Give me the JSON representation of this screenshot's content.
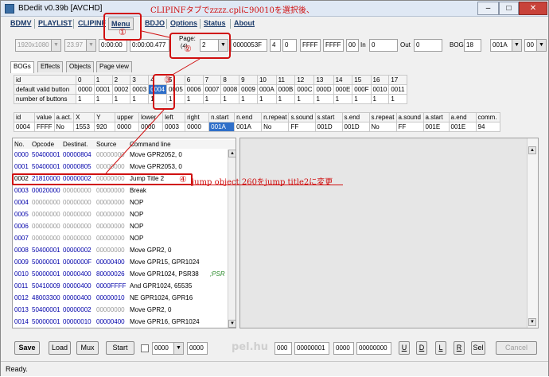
{
  "window": {
    "title": "BDedit v0.39b [AVCHD]",
    "close": "✕",
    "minimize": "–",
    "maximize": "□"
  },
  "annotations": {
    "top": "CLIPINFタブでzzzz.cplに90010を選択後、",
    "n1": "①",
    "n2": "②",
    "n3": "③",
    "n4": "④",
    "n4_text": "jump object 260をjump title2に変更"
  },
  "menu": {
    "items": [
      "BDMV",
      "PLAYLIST",
      "CLIPINF",
      "Menu",
      "BDJO",
      "Options",
      "Status",
      "About"
    ],
    "active": "Menu"
  },
  "toolbar": {
    "resolution": "1920x1080",
    "fps": "23.97",
    "time_in": "0:00:00",
    "time_out": "0:00:00.477",
    "page_label": "Page:",
    "page_count": "(4)",
    "page_value": "2",
    "hex1": "0000053F",
    "field_4": "4",
    "field_0": "0",
    "ffff1": "FFFF",
    "ffff2": "FFFF",
    "f00": "00",
    "in_label": "In",
    "in_value": "0",
    "out_label": "Out",
    "out_value": "0",
    "bog_label": "BOG",
    "bog_value": "18",
    "right_combo": "001A",
    "right_combo2": "00"
  },
  "tabs": [
    "BOGs",
    "Effects",
    "Objects",
    "Page view"
  ],
  "bog_table": {
    "row_id_label": "id",
    "columns": [
      "0",
      "1",
      "2",
      "3",
      "4",
      "5",
      "6",
      "7",
      "8",
      "9",
      "10",
      "11",
      "12",
      "13",
      "14",
      "15",
      "16",
      "17"
    ],
    "default_label": "default valid button",
    "default_values": [
      "0000",
      "0001",
      "0002",
      "0003",
      "0004",
      "0005",
      "0006",
      "0007",
      "0008",
      "0009",
      "000A",
      "000B",
      "000C",
      "000D",
      "000E",
      "000F",
      "0010",
      "0011"
    ],
    "count_label": "number of buttons",
    "count_values": [
      "1",
      "1",
      "1",
      "1",
      "1",
      "1",
      "1",
      "1",
      "1",
      "1",
      "1",
      "1",
      "1",
      "1",
      "1",
      "1",
      "1",
      "1"
    ]
  },
  "button_table": {
    "headers": [
      "id",
      "value",
      "a.act.",
      "X",
      "Y",
      "upper",
      "lower",
      "left",
      "right",
      "n.start",
      "n.end",
      "n.repeat",
      "s.sound",
      "s.start",
      "s.end",
      "s.repeat",
      "a.sound",
      "a.start",
      "a.end",
      "comm."
    ],
    "row": [
      "0004",
      "FFFF",
      "No",
      "1553",
      "920",
      "0000",
      "0000",
      "0003",
      "0000",
      "001A",
      "001A",
      "No",
      "FF",
      "001D",
      "001D",
      "No",
      "FF",
      "001E",
      "001E",
      "94"
    ]
  },
  "commands": {
    "headers": [
      "No.",
      "Opcode",
      "Destinat.",
      "Source",
      "Command line"
    ],
    "rows": [
      {
        "no": "0000",
        "op": "50400001",
        "dst": "00000804",
        "src": "00000000",
        "cmd": "Move GPR2052, 0",
        "note": ""
      },
      {
        "no": "0001",
        "op": "50400001",
        "dst": "00000805",
        "src": "00000000",
        "cmd": "Move GPR2053, 0",
        "note": ""
      },
      {
        "no": "0002",
        "op": "21810000",
        "dst": "00000002",
        "src": "00000000",
        "cmd": "Jump Title 2",
        "note": ""
      },
      {
        "no": "0003",
        "op": "00020000",
        "dst": "00000000",
        "src": "00000000",
        "cmd": "Break",
        "note": ""
      },
      {
        "no": "0004",
        "op": "00000000",
        "dst": "00000000",
        "src": "00000000",
        "cmd": "NOP",
        "note": ""
      },
      {
        "no": "0005",
        "op": "00000000",
        "dst": "00000000",
        "src": "00000000",
        "cmd": "NOP",
        "note": ""
      },
      {
        "no": "0006",
        "op": "00000000",
        "dst": "00000000",
        "src": "00000000",
        "cmd": "NOP",
        "note": ""
      },
      {
        "no": "0007",
        "op": "00000000",
        "dst": "00000000",
        "src": "00000000",
        "cmd": "NOP",
        "note": ""
      },
      {
        "no": "0008",
        "op": "50400001",
        "dst": "00000002",
        "src": "00000000",
        "cmd": "Move GPR2, 0",
        "note": ""
      },
      {
        "no": "0009",
        "op": "50000001",
        "dst": "0000000F",
        "src": "00000400",
        "cmd": "Move GPR15, GPR1024",
        "note": ""
      },
      {
        "no": "0010",
        "op": "50000001",
        "dst": "00000400",
        "src": "80000026",
        "cmd": "Move GPR1024, PSR38",
        "note": ";PSR"
      },
      {
        "no": "0011",
        "op": "50410009",
        "dst": "00000400",
        "src": "0000FFFF",
        "cmd": "And GPR1024, 65535",
        "note": ""
      },
      {
        "no": "0012",
        "op": "48003300",
        "dst": "00000400",
        "src": "00000010",
        "cmd": "NE GPR1024, GPR16",
        "note": ""
      },
      {
        "no": "0013",
        "op": "50400001",
        "dst": "00000002",
        "src": "00000000",
        "cmd": "Move GPR2, 0",
        "note": ""
      },
      {
        "no": "0014",
        "op": "50000001",
        "dst": "00000010",
        "src": "00000400",
        "cmd": "Move GPR16, GPR1024",
        "note": ""
      }
    ]
  },
  "bottom": {
    "save": "Save",
    "load": "Load",
    "mux": "Mux",
    "start": "Start",
    "combo1": "0000",
    "field1": "0000",
    "watermark": "pel.hu",
    "f000": "000",
    "hex_a": "00000001",
    "f0000": "0000",
    "hex_b": "00000000",
    "btn_u": "U",
    "btn_d": "D",
    "btn_l": "L",
    "btn_r": "R",
    "btn_sel": "Sel",
    "cancel": "Cancel"
  },
  "status": "Ready."
}
